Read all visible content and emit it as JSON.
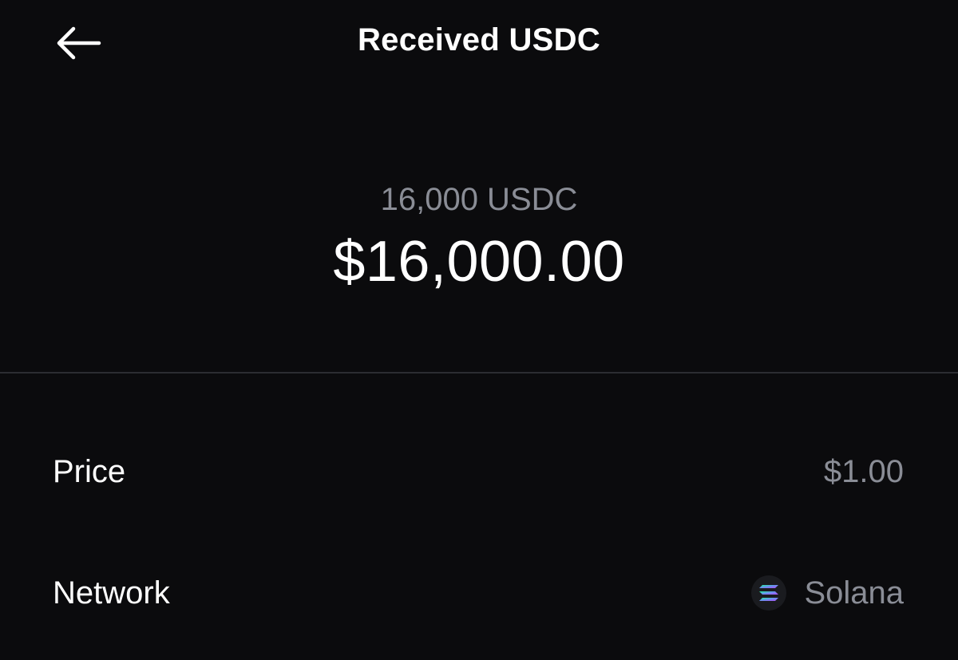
{
  "header": {
    "title": "Received USDC",
    "back_icon": "arrow-left-icon"
  },
  "amount": {
    "crypto": "16,000 USDC",
    "fiat": "$16,000.00"
  },
  "details": {
    "price": {
      "label": "Price",
      "value": "$1.00"
    },
    "network": {
      "label": "Network",
      "value": "Solana",
      "icon": "solana-logo-icon"
    }
  },
  "colors": {
    "background": "#0b0b0d",
    "primary_text": "#ffffff",
    "secondary_text": "#8a8d96",
    "divider": "#2c2d31"
  }
}
